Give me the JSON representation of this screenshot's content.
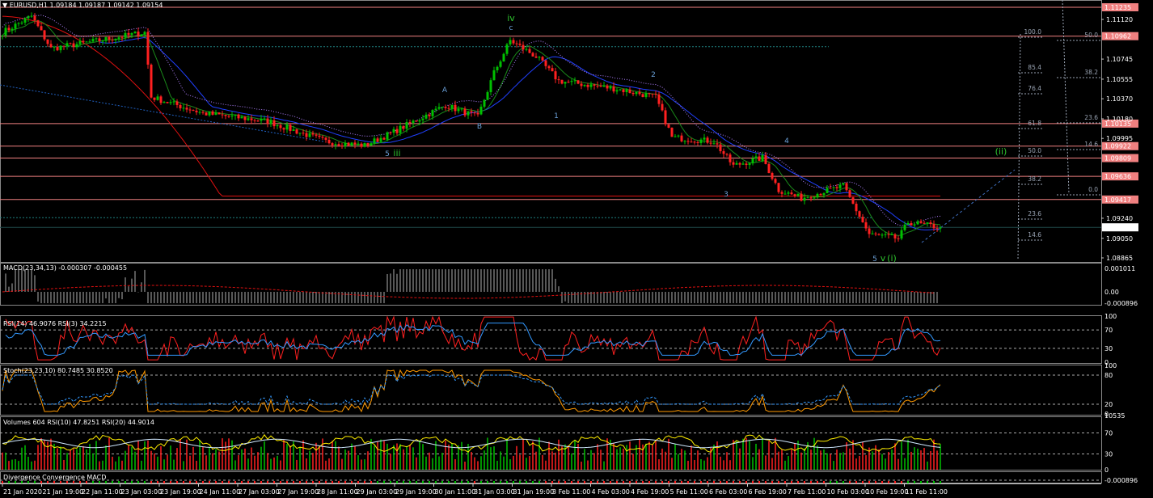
{
  "header": {
    "title": "EURUSD,H1  1.09184 1.09187 1.09142 1.09154"
  },
  "indicators": {
    "macd": "MACD(23,34,13) -0.000307 -0.000455",
    "rsi": "RSI(14) 46.9076  RSI(3) 34.2215",
    "stoch": "Stoch(23,23,10) 80.7485 30.8520",
    "volumes": "Volumes 604  RSI(10) 47.8251  RSI(20) 44.9014",
    "dcm": "Divergence Convergence MACD"
  },
  "colors": {
    "bull": "#00c000",
    "bear": "#ff2020",
    "level": "#f08080",
    "ma200": "#e01010",
    "ma_blue": "#2040ff",
    "rsi": "#ff2020",
    "rsi_slow": "#3399ff",
    "stoch": "#ff9900"
  },
  "chart_data": {
    "type": "candlestick",
    "symbol": "EURUSD",
    "timeframe": "H1",
    "ylim": [
      1.08865,
      1.11235
    ],
    "price_path": [
      [
        0,
        1.10998
      ],
      [
        9,
        1.11151
      ],
      [
        15,
        1.10845
      ],
      [
        30,
        1.10922
      ],
      [
        44,
        1.10998
      ],
      [
        46,
        1.10386
      ],
      [
        62,
        1.10233
      ],
      [
        82,
        1.10157
      ],
      [
        100,
        1.09966
      ],
      [
        112,
        1.09928
      ],
      [
        120,
        1.10042
      ],
      [
        137,
        1.1031
      ],
      [
        147,
        1.10195
      ],
      [
        152,
        1.10616
      ],
      [
        157,
        1.10922
      ],
      [
        165,
        1.10769
      ],
      [
        172,
        1.10539
      ],
      [
        190,
        1.10463
      ],
      [
        202,
        1.10386
      ],
      [
        207,
        1.10004
      ],
      [
        220,
        1.09966
      ],
      [
        226,
        1.09736
      ],
      [
        235,
        1.09813
      ],
      [
        240,
        1.09507
      ],
      [
        247,
        1.09431
      ],
      [
        260,
        1.09545
      ],
      [
        268,
        1.09087
      ],
      [
        277,
        1.09049
      ],
      [
        280,
        1.09202
      ],
      [
        290,
        1.09154
      ]
    ],
    "last_price": "1.09154",
    "price_levels": [
      "1.11235",
      "1.10962",
      "1.10135",
      "1.09922",
      "1.09809",
      "1.09636",
      "1.09417"
    ],
    "price_ticks": [
      "1.11120",
      "1.10745",
      "1.10555",
      "1.10370",
      "1.10180",
      "1.09995",
      "1.09240",
      "1.09050",
      "1.08865"
    ],
    "fib_left": [
      "100.0",
      "85.4",
      "76.4",
      "61.8",
      "50.0",
      "38.2",
      "23.6",
      "14.6"
    ],
    "fib_right": [
      "50.0",
      "38.2",
      "23.6",
      "14.6",
      "0.0"
    ],
    "wave_labels": [
      "iv",
      "c",
      "iii",
      "5",
      "A",
      "B",
      "1",
      "2",
      "3",
      "4",
      "5",
      "v",
      "(i)",
      "(ii)"
    ],
    "time_labels": [
      "21 Jan 2020",
      "21 Jan 19:00",
      "22 Jan 11:00",
      "23 Jan 03:00",
      "23 Jan 19:00",
      "24 Jan 11:00",
      "27 Jan 03:00",
      "27 Jan 19:00",
      "28 Jan 11:00",
      "29 Jan 03:00",
      "29 Jan 19:00",
      "30 Jan 11:00",
      "31 Jan 03:00",
      "31 Jan 19:00",
      "3 Feb 11:00",
      "4 Feb 03:00",
      "4 Feb 19:00",
      "5 Feb 11:00",
      "6 Feb 03:00",
      "6 Feb 19:00",
      "7 Feb 11:00",
      "10 Feb 03:00",
      "10 Feb 19:00",
      "11 Feb 11:00"
    ],
    "macd_scale": [
      "0.001011",
      "0.00",
      "-0.000896"
    ],
    "rsi_scale": [
      "100",
      "70",
      "30",
      "0"
    ],
    "stoch_scale": [
      "100",
      "80",
      "20",
      "0"
    ],
    "vol_scale": [
      "10535",
      "70",
      "30",
      "0"
    ],
    "dcm_scale": [
      "-0.000896"
    ]
  }
}
